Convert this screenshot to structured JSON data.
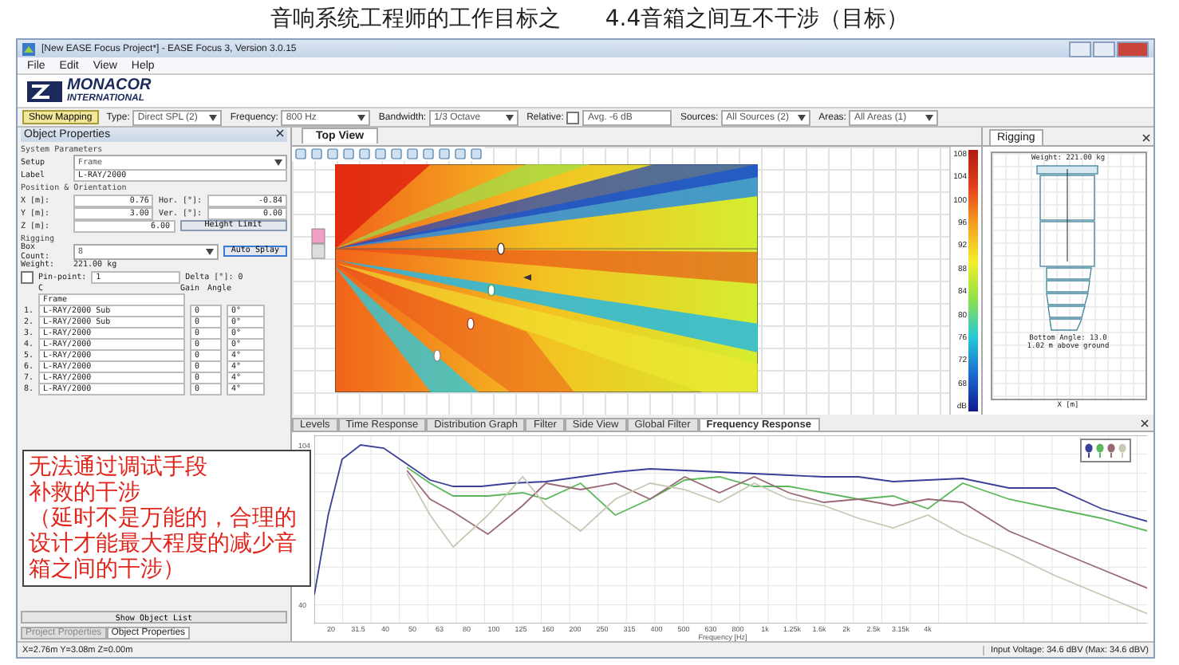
{
  "slide": {
    "title_left": "音响系统工程师的工作目标之",
    "title_right": "4.4音箱之间互不干涉（目标）"
  },
  "window": {
    "title": "[New EASE Focus Project*] - EASE Focus 3, Version 3.0.15"
  },
  "menu": [
    "File",
    "Edit",
    "View",
    "Help"
  ],
  "logo": {
    "name": "MONACOR",
    "sub": "INTERNATIONAL"
  },
  "toolbar": {
    "show_mapping": {
      "label": "Show Mapping",
      "selected": true
    },
    "fields": [
      {
        "kind": "dropdown",
        "label": "Type:",
        "value": "Direct SPL (2)"
      },
      {
        "kind": "dropdown",
        "label": "Frequency:",
        "value": "800 Hz"
      },
      {
        "kind": "dropdown",
        "label": "Bandwidth:",
        "value": "1/3 Octave"
      },
      {
        "kind": "check",
        "label": "Relative:",
        "value": "Avg. -6 dB",
        "checked": false
      },
      {
        "kind": "dropdown",
        "label": "Sources:",
        "value": "All Sources (2)"
      },
      {
        "kind": "dropdown",
        "label": "Areas:",
        "value": "All Areas (1)"
      }
    ]
  },
  "object_properties": {
    "title": "Object Properties",
    "section_system": "System Parameters",
    "setup": {
      "label": "Setup",
      "value": "Frame"
    },
    "label_field": {
      "label": "Label",
      "value": "L-RAY/2000"
    },
    "section_position": "Position & Orientation",
    "position": [
      {
        "label": "X [m]:",
        "value": "0.76",
        "angle_label": "Hor. [°]:",
        "angle_value": "-0.84"
      },
      {
        "label": "Y [m]:",
        "value": "3.00",
        "angle_label": "Ver. [°]:",
        "angle_value": "0.00"
      },
      {
        "label": "Z [m]:",
        "value": "6.00"
      }
    ],
    "height_limit": "Height Limit",
    "section_rigging": "Rigging",
    "box_count": {
      "label": "Box Count:",
      "value": "8"
    },
    "auto_splay": "Auto Splay",
    "weight": {
      "label": "Weight:",
      "value": "221.00 kg"
    },
    "pin_point": {
      "label": "Pin-point:",
      "checked": false,
      "value": "1",
      "delta": "Delta [°]: 0"
    },
    "columns": [
      "C",
      "Gain",
      "Angle"
    ],
    "frame": "Frame",
    "boxes": [
      {
        "index": "1.",
        "name": "L-RAY/2000 Sub",
        "gain": "0",
        "angle": "0°"
      },
      {
        "index": "2.",
        "name": "L-RAY/2000 Sub",
        "gain": "0",
        "angle": "0°"
      },
      {
        "index": "3.",
        "name": "L-RAY/2000",
        "gain": "0",
        "angle": "0°"
      },
      {
        "index": "4.",
        "name": "L-RAY/2000",
        "gain": "0",
        "angle": "0°"
      },
      {
        "index": "5.",
        "name": "L-RAY/2000",
        "gain": "0",
        "angle": "4°"
      },
      {
        "index": "6.",
        "name": "L-RAY/2000",
        "gain": "0",
        "angle": "4°"
      },
      {
        "index": "7.",
        "name": "L-RAY/2000",
        "gain": "0",
        "angle": "4°"
      },
      {
        "index": "8.",
        "name": "L-RAY/2000",
        "gain": "0",
        "angle": "4°"
      }
    ],
    "show_object_list": "Show Object List",
    "bottom_tabs": [
      {
        "label": "Project Properties",
        "selected": false
      },
      {
        "label": "Object Properties",
        "selected": true
      }
    ]
  },
  "top_view": {
    "tab": "Top View",
    "scale": [
      "108",
      "104",
      "100",
      "96",
      "92",
      "88",
      "84",
      "80",
      "76",
      "72",
      "68"
    ],
    "unit": "dB"
  },
  "rigging": {
    "tab": "Rigging",
    "weight": "Weight: 221.00 kg",
    "bottom_angle": "Bottom Angle: 13.0",
    "above_ground": "1.02 m above ground",
    "x_axis": "X [m]"
  },
  "analysis_tabs": [
    {
      "label": "Levels",
      "selected": false
    },
    {
      "label": "Time Response",
      "selected": false
    },
    {
      "label": "Distribution Graph",
      "selected": false
    },
    {
      "label": "Filter",
      "selected": false
    },
    {
      "label": "Side View",
      "selected": false
    },
    {
      "label": "Global Filter",
      "selected": false
    },
    {
      "label": "Frequency Response",
      "selected": true
    }
  ],
  "frequency_response": {
    "y_ticks": [
      "104",
      "40"
    ],
    "x_ticks": [
      "20",
      "31.5",
      "40",
      "50",
      "63",
      "80",
      "100",
      "125",
      "160",
      "200",
      "250",
      "315",
      "400",
      "500",
      "630",
      "800",
      "1k",
      "1.25k",
      "1.6k",
      "2k",
      "2.5k",
      "3.15k",
      "4k"
    ],
    "x_label": "Frequency [Hz]",
    "sources": [
      {
        "color": "#3a3f9a"
      },
      {
        "color": "#5cb85c"
      },
      {
        "color": "#9a6a74"
      },
      {
        "color": "#c8c8b4"
      }
    ]
  },
  "callout": {
    "lines": [
      "无法通过调试手段",
      "补救的干涉",
      "（延时不是万能的，合理的设计才能最大程度的减少音箱之间的干涉）"
    ]
  },
  "status_bar": {
    "coords": "X=2.76m Y=3.08m Z=0.00m",
    "input_voltage": "Input Voltage: 34.6 dBV (Max: 34.6 dBV)"
  }
}
